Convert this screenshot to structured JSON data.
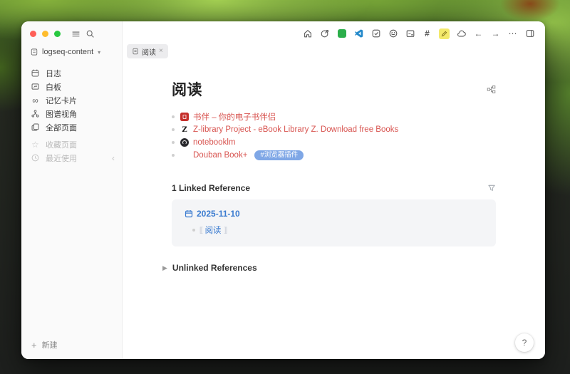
{
  "colors": {
    "accent_red": "#d85450",
    "accent_blue": "#3a7bd0",
    "tag_bg": "#7fa7e6",
    "plugin_green": "#2bae4a",
    "vscode_blue": "#2489ca",
    "highlight_yellow": "#f3e96b",
    "sidebar_bg": "#fafafa",
    "ref_card_bg": "#f4f5f7"
  },
  "titlebar": {
    "graph_name": "logseq-content"
  },
  "toolbar": {
    "icons": [
      "home",
      "share",
      "plugin-green-square",
      "vscode",
      "tasks",
      "smiley-plugin",
      "card",
      "hash",
      "highlighter",
      "plugins-cloud",
      "back",
      "forward",
      "more",
      "right-sidebar-toggle"
    ]
  },
  "tabs": {
    "active": "阅读"
  },
  "sidebar": {
    "items": [
      {
        "label": "日志",
        "icon": "calendar"
      },
      {
        "label": "白板",
        "icon": "whiteboard"
      },
      {
        "label": "记忆卡片",
        "icon": "flashcards"
      },
      {
        "label": "图谱视角",
        "icon": "graph"
      },
      {
        "label": "全部页面",
        "icon": "pages"
      },
      {
        "label": "收藏页面",
        "icon": "star"
      },
      {
        "label": "最近使用",
        "icon": "clock"
      }
    ],
    "new_label": "新建"
  },
  "page": {
    "title": "阅读",
    "bullets": [
      {
        "text": "书伴 – 你的电子书伴侣",
        "icon": "book-favicon"
      },
      {
        "text": "Z-library Project - eBook Library Z. Download free Books",
        "icon": "zlibrary-favicon"
      },
      {
        "text": "notebooklm",
        "icon": "notebooklm-favicon"
      },
      {
        "text": "Douban Book+",
        "icon": "douban-favicon",
        "tag": "#浏览器插件"
      }
    ],
    "linked_references": {
      "header": "1 Linked Reference",
      "entries": [
        {
          "date": "2025-11-10",
          "refs": [
            "阅读"
          ]
        }
      ]
    },
    "unlinked_references": {
      "header": "Unlinked References"
    }
  },
  "help_label": "?",
  "glyphs": {
    "hash": "#",
    "more": "⋯",
    "back": "←",
    "forward": "→",
    "infinity": "∞",
    "star": "☆",
    "chevron_left": "‹",
    "caret_down": "▾",
    "collapse_arrow": "▶",
    "close": "×",
    "plus": "+",
    "brackets_open": "[[",
    "brackets_close": "]]"
  }
}
